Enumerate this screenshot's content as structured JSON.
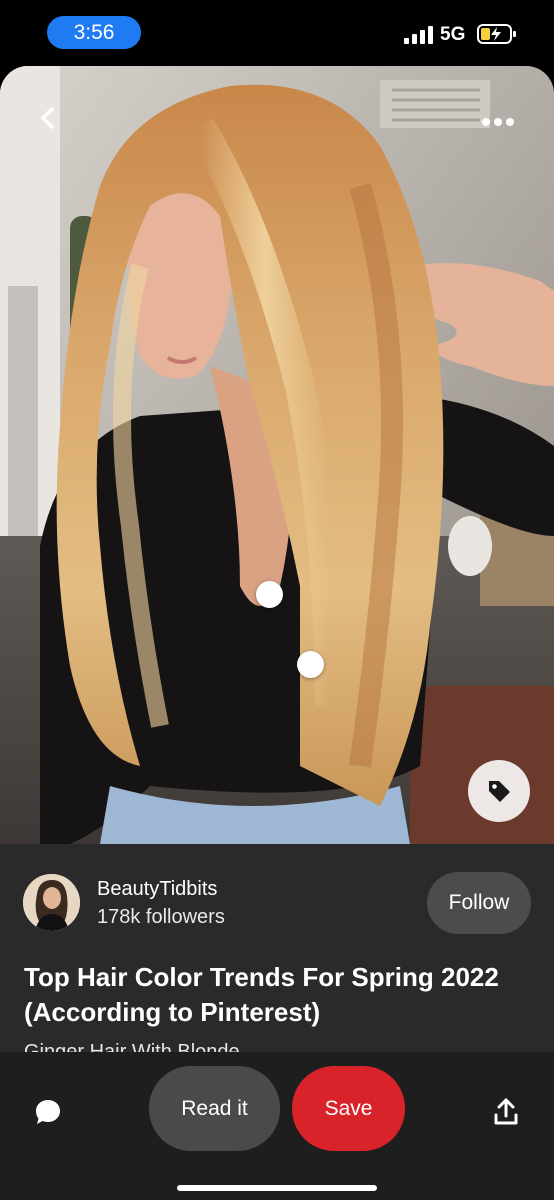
{
  "status_bar": {
    "time": "3:56",
    "network": "5G"
  },
  "pin": {
    "image_icons": {
      "back": "chevron-left-icon",
      "more": "more-horizontal-icon",
      "tag": "tag-icon"
    }
  },
  "creator": {
    "name": "BeautyTidbits",
    "followers": "178k followers",
    "follow_label": "Follow"
  },
  "details": {
    "title": "Top Hair Color Trends For Spring 2022 (According to Pinterest)",
    "description": "Ginger Hair With Blonde"
  },
  "actions": {
    "read_label": "Read it",
    "save_label": "Save",
    "comment_icon": "comment-icon",
    "share_icon": "share-icon"
  },
  "colors": {
    "accent_blue": "#1f7bf2",
    "save_red": "#d8232a",
    "sheet_bg": "#2a2a2a"
  }
}
